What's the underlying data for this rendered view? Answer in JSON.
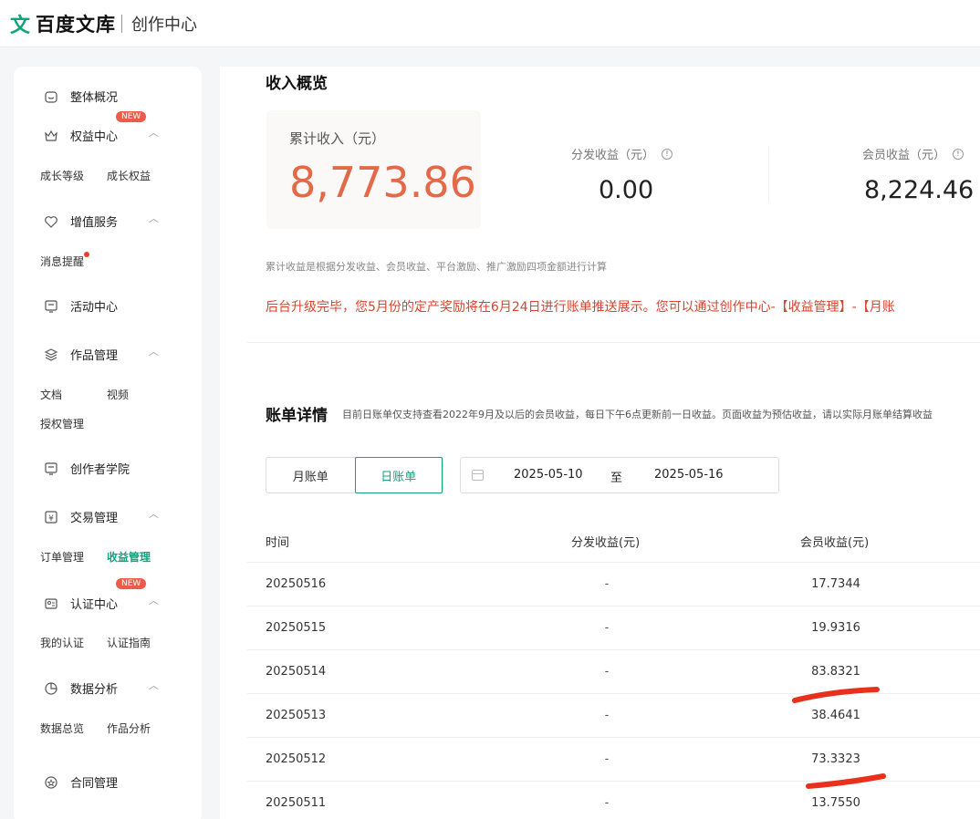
{
  "header": {
    "logo_mark": "文",
    "brand": "百度文库",
    "section": "创作中心"
  },
  "sidebar": {
    "overview": "整体概况",
    "benefits": {
      "label": "权益中心",
      "badge": "NEW",
      "subs": [
        "成长等级",
        "成长权益"
      ]
    },
    "value_added": {
      "label": "增值服务",
      "subs": [
        "消息提醒"
      ]
    },
    "activity": "活动中心",
    "works": {
      "label": "作品管理",
      "subs": [
        "文档",
        "视频",
        "授权管理"
      ]
    },
    "academy": "创作者学院",
    "trade": {
      "label": "交易管理",
      "subs": [
        "订单管理",
        "收益管理"
      ]
    },
    "cert": {
      "label": "认证中心",
      "badge": "NEW",
      "subs": [
        "我的认证",
        "认证指南"
      ]
    },
    "analytics": {
      "label": "数据分析",
      "subs": [
        "数据总览",
        "作品分析"
      ]
    },
    "contract": "合同管理"
  },
  "income": {
    "title": "收入概览",
    "total_label": "累计收入（元）",
    "total_value": "8,773.86",
    "distribution_label": "分发收益（元）",
    "distribution_value": "0.00",
    "member_label": "会员收益（元）",
    "member_value": "8,224.46",
    "note": "累计收益是根据分发收益、会员收益、平台激励、推广激励四项金额进行计算",
    "notice": "后台升级完毕，您5月份的定产奖励将在6月24日进行账单推送展示。您可以通过创作中心-【收益管理】-【月账"
  },
  "bill": {
    "title": "账单详情",
    "subtitle": "目前日账单仅支持查看2022年9月及以后的会员收益，每日下午6点更新前一日收益。页面收益为预估收益，请以实际月账单结算收益",
    "tabs": [
      "月账单",
      "日账单"
    ],
    "active_tab": "日账单",
    "date_from": "2025-05-10",
    "date_to_sep": "至",
    "date_to": "2025-05-16",
    "columns": [
      "时间",
      "分发收益(元)",
      "会员收益(元)"
    ],
    "rows": [
      {
        "date": "20250516",
        "dist": "-",
        "member": "17.7344"
      },
      {
        "date": "20250515",
        "dist": "-",
        "member": "19.9316"
      },
      {
        "date": "20250514",
        "dist": "-",
        "member": "83.8321"
      },
      {
        "date": "20250513",
        "dist": "-",
        "member": "38.4641"
      },
      {
        "date": "20250512",
        "dist": "-",
        "member": "73.3323"
      },
      {
        "date": "20250511",
        "dist": "-",
        "member": "13.7550"
      }
    ]
  },
  "colors": {
    "accent": "#13a37e",
    "total": "#e26a48",
    "notice": "#d9432f",
    "annotation": "#e8301c"
  }
}
